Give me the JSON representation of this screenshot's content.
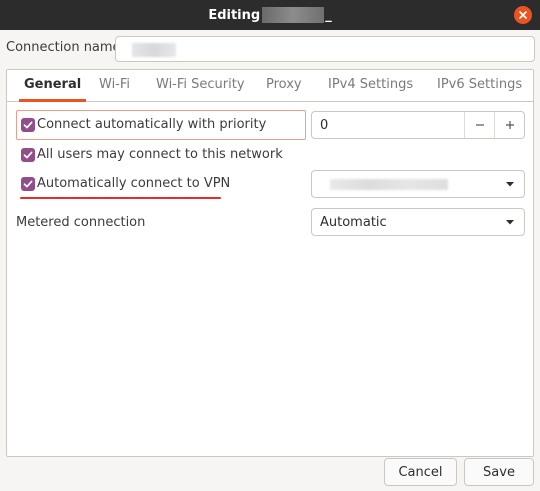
{
  "window": {
    "title": "Editing",
    "title_suffix": "_"
  },
  "connection": {
    "name_label": "Connection name"
  },
  "tabs": [
    {
      "label": "General"
    },
    {
      "label": "Wi-Fi"
    },
    {
      "label": "Wi-Fi Security"
    },
    {
      "label": "Proxy"
    },
    {
      "label": "IPv4 Settings"
    },
    {
      "label": "IPv6 Settings"
    }
  ],
  "general": {
    "auto_connect_label": "Connect automatically with priority",
    "auto_connect_checked": true,
    "priority_value": "0",
    "all_users_label": "All users may connect to this network",
    "all_users_checked": true,
    "auto_vpn_label": "Automatically connect to VPN",
    "auto_vpn_checked": true,
    "metered_label": "Metered connection",
    "metered_value": "Automatic"
  },
  "buttons": {
    "cancel": "Cancel",
    "save": "Save"
  },
  "colors": {
    "titlebar": "#2c2c2c",
    "accent": "#e95420",
    "checkbox": "#924d8b",
    "annotation": "#e52b2b"
  },
  "icons": {
    "close": "close-icon",
    "check": "check-icon",
    "minus": "minus-icon",
    "plus": "plus-icon",
    "dropdown": "chevron-down-icon"
  }
}
